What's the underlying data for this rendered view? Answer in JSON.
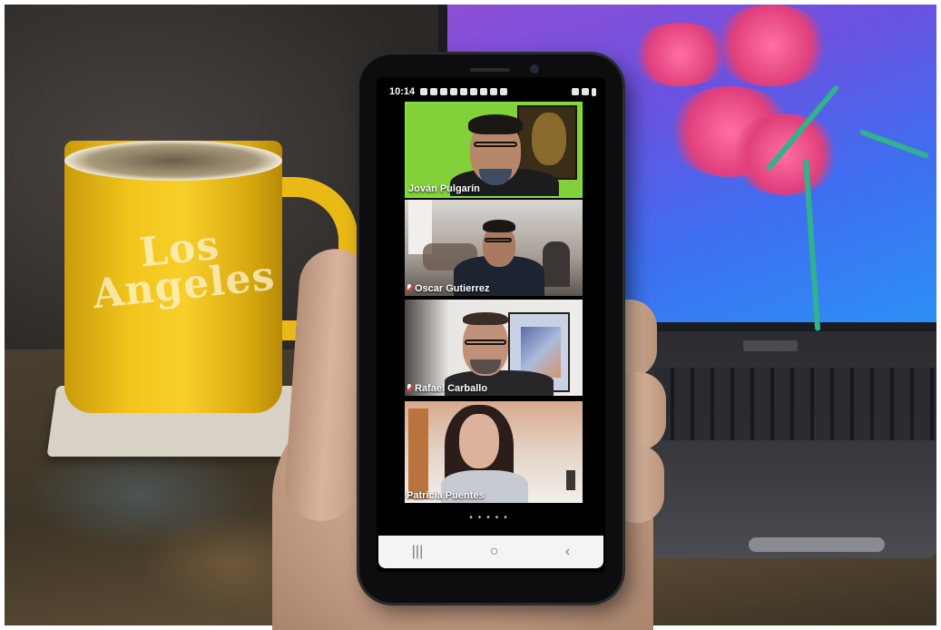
{
  "phone": {
    "status_time": "10:14",
    "page_dots": "•••••"
  },
  "participants": [
    {
      "name": "Jován Pulgarín",
      "muted": false,
      "active_speaker": true
    },
    {
      "name": "Oscar Gutierrez",
      "muted": true,
      "active_speaker": false
    },
    {
      "name": "Rafael Carballo",
      "muted": true,
      "active_speaker": false
    },
    {
      "name": "Patricia Puentes",
      "muted": false,
      "active_speaker": false
    }
  ],
  "nav": {
    "recents": "|||",
    "home": "○",
    "back": "‹"
  },
  "mug": {
    "text": "Los Angeles"
  },
  "colors": {
    "active_speaker_border": "#7ee33a",
    "mug_yellow": "#f2c51c",
    "laptop_wallpaper": "#6a52e0"
  }
}
